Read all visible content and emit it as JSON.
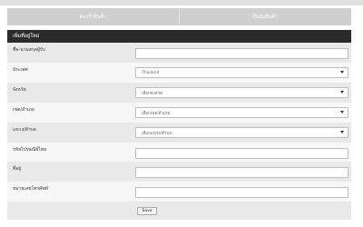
{
  "tabs": [
    {
      "label": "ตะกร้าสินค้า"
    },
    {
      "label": "ยืนยันสินค้า"
    }
  ],
  "section": {
    "title": "เพิ่มที่อยู่ใหม่"
  },
  "form": {
    "recipient_label": "ชื่อ-นามสกุลผู้รับ",
    "recipient_value": "",
    "country_label": "ประเทศ",
    "country_value": "Thailand",
    "province_label": "จังหวัด",
    "province_value": "เลือกจังหวัด",
    "district_label": "เขต/อำเภอ",
    "district_value": "เลือกเขต/อำเภอ",
    "subdistrict_label": "แขวง/ตำบล",
    "subdistrict_value": "เลือกแขวง/ตำบล",
    "postcode_label": "รหัสไปรษณีย์ไทย",
    "postcode_value": "",
    "address_label": "ที่อยู่",
    "address_value": "",
    "phone_label": "หมายเลขโทรศัพท์",
    "phone_value": "",
    "save_label": "Save"
  }
}
